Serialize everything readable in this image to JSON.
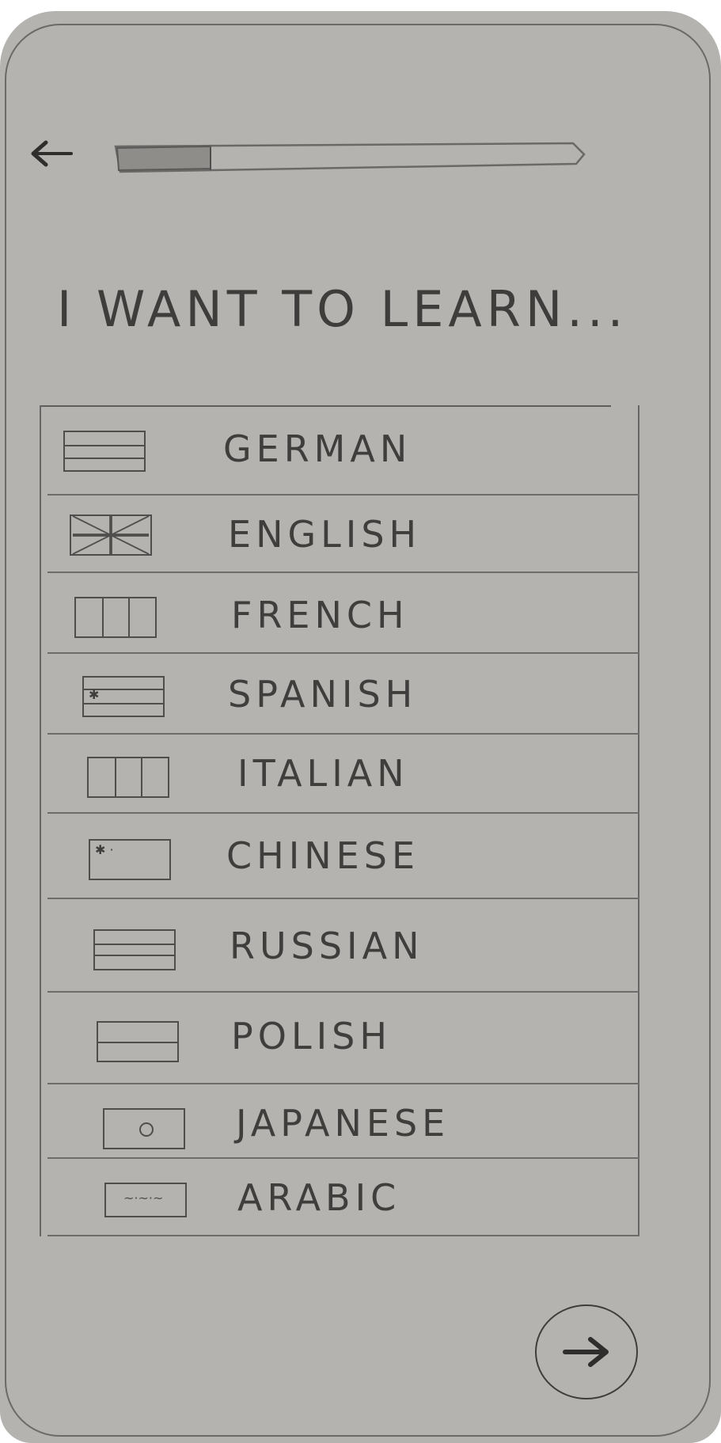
{
  "header": {
    "back_icon": "arrow-left-icon",
    "progress": 0.2
  },
  "heading": "I WANT TO LEARN...",
  "languages": [
    {
      "label": "GERMAN",
      "flag": "horizontal-stripes-flag-icon"
    },
    {
      "label": "ENGLISH",
      "flag": "union-jack-flag-icon"
    },
    {
      "label": "FRENCH",
      "flag": "vertical-tricolor-flag-icon"
    },
    {
      "label": "SPANISH",
      "flag": "spain-flag-icon"
    },
    {
      "label": "ITALIAN",
      "flag": "vertical-tricolor-flag-icon"
    },
    {
      "label": "CHINESE",
      "flag": "star-flag-icon"
    },
    {
      "label": "RUSSIAN",
      "flag": "horizontal-stripes-flag-icon"
    },
    {
      "label": "POLISH",
      "flag": "bicolor-flag-icon"
    },
    {
      "label": "JAPANESE",
      "flag": "circle-flag-icon"
    },
    {
      "label": "ARABIC",
      "flag": "script-flag-icon"
    }
  ],
  "next_button": {
    "icon": "arrow-right-icon"
  },
  "colors": {
    "paper": "#b5b3b0",
    "pencil": "#3e3d3c"
  }
}
